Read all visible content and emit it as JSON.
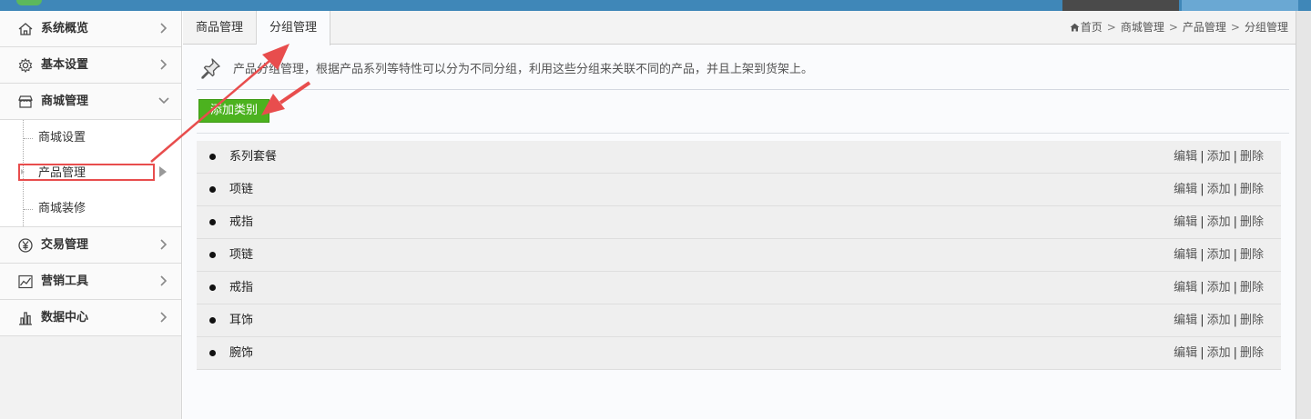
{
  "sidebar": {
    "items": [
      {
        "label": "系统概览",
        "icon": "home-icon"
      },
      {
        "label": "基本设置",
        "icon": "gear-icon"
      },
      {
        "label": "商城管理",
        "icon": "store-icon",
        "expanded": true
      },
      {
        "label": "交易管理",
        "icon": "yen-circle-icon"
      },
      {
        "label": "营销工具",
        "icon": "trend-chart-icon"
      },
      {
        "label": "数据中心",
        "icon": "bar-chart-icon"
      }
    ],
    "sub_items": [
      {
        "label": "商城设置"
      },
      {
        "label": "产品管理",
        "active": true
      },
      {
        "label": "商城装修"
      }
    ]
  },
  "tabs": [
    {
      "label": "商品管理"
    },
    {
      "label": "分组管理",
      "active": true
    }
  ],
  "breadcrumb": {
    "home": "首页",
    "sep": ">",
    "items": [
      "商城管理",
      "产品管理",
      "分组管理"
    ]
  },
  "notice": {
    "text": "产品分组管理，根据产品系列等特性可以分为不同分组，利用这些分组来关联不同的产品，并且上架到货架上。"
  },
  "add_button": {
    "label": "添加类别"
  },
  "actions": {
    "edit": "编辑",
    "add": "添加",
    "delete": "删除",
    "sep": "|"
  },
  "categories": [
    {
      "name": "系列套餐"
    },
    {
      "name": "项链"
    },
    {
      "name": "戒指"
    },
    {
      "name": "项链"
    },
    {
      "name": "戒指"
    },
    {
      "name": "耳饰"
    },
    {
      "name": "腕饰"
    }
  ],
  "colors": {
    "topbar": "#3f87b8",
    "add_button": "#4cb21f",
    "annotation": "#e84d4d"
  }
}
